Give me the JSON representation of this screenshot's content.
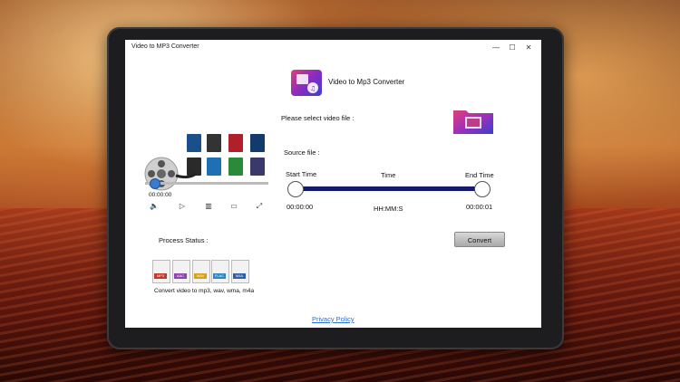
{
  "window": {
    "title": "Video to MP3 Converter",
    "controls": {
      "minimize": "—",
      "maximize": "☐",
      "close": "✕"
    }
  },
  "app": {
    "name": "Video to Mp3 Converter"
  },
  "labels": {
    "select_file": "Please select video file :",
    "source_file": "Source file :",
    "start_time": "Start Time",
    "time": "Time",
    "end_time": "End Time",
    "start_value": "00:00:00",
    "format": "HH:MM:S",
    "end_value": "00:00:01",
    "process_status": "Process Status :",
    "formats_caption": "Convert video to  mp3, wav, wma, m4a"
  },
  "player": {
    "timestamp": "00:00:00",
    "controls": [
      "volume-icon",
      "play-icon",
      "frame-icon",
      "screenshot-icon",
      "fullscreen-icon"
    ]
  },
  "buttons": {
    "convert": "Convert"
  },
  "links": {
    "privacy": "Privacy Policy"
  },
  "file_formats": [
    {
      "ext": "MP3",
      "color": "#c0392b"
    },
    {
      "ext": "AAC",
      "color": "#8e44ad"
    },
    {
      "ext": "WAV",
      "color": "#d4a017"
    },
    {
      "ext": "FLAC",
      "color": "#2e86c1"
    },
    {
      "ext": "M4A",
      "color": "#2e5fa8"
    }
  ],
  "colors": {
    "accent": "#161a6c",
    "link": "#2a6fd1"
  }
}
